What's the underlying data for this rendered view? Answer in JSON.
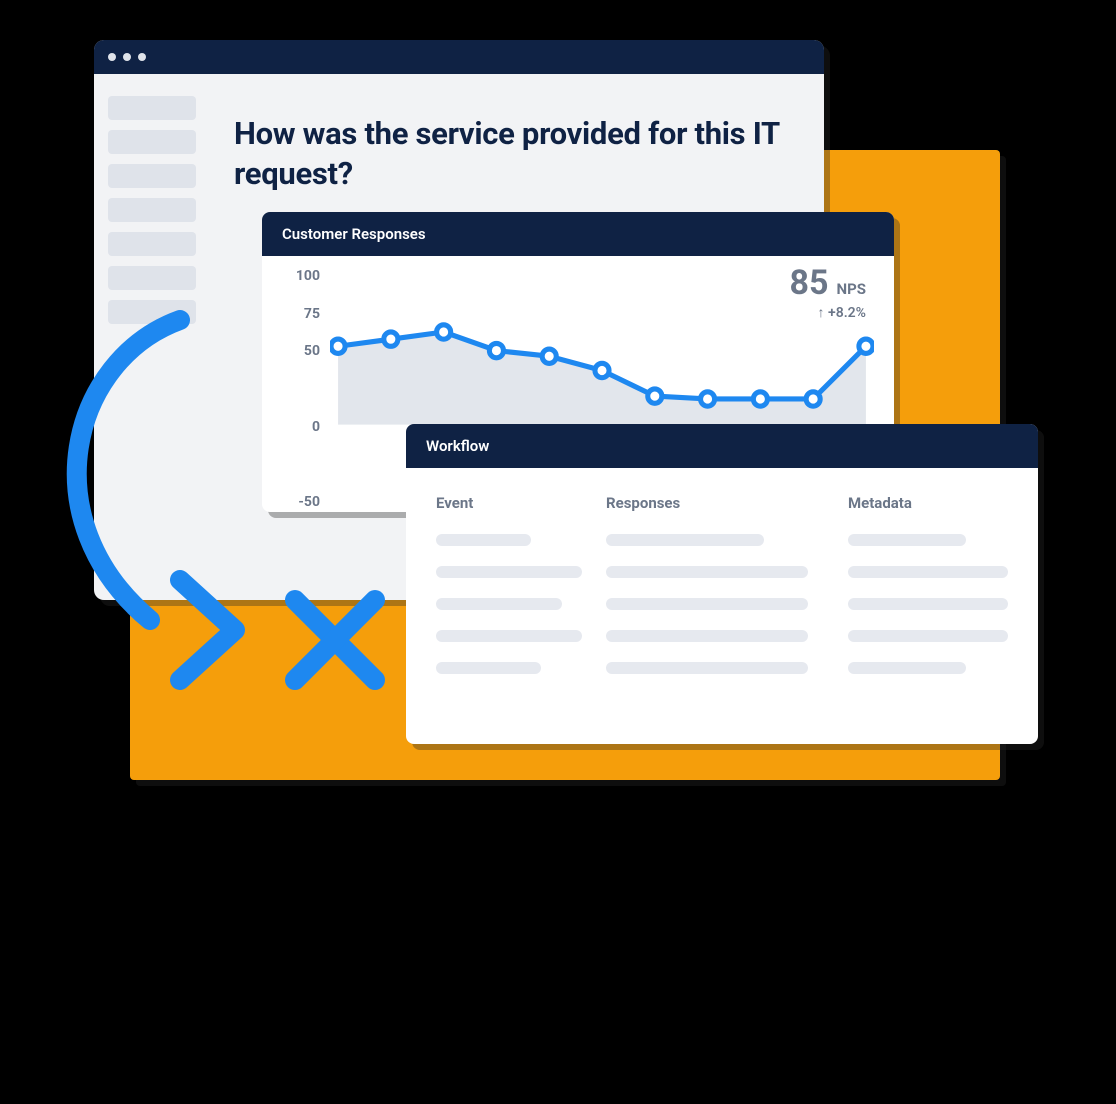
{
  "survey": {
    "question": "How was the service provided for this IT request?",
    "sidebar_items": 7
  },
  "responses_card": {
    "title": "Customer Responses",
    "metric_value": "85",
    "metric_unit": "NPS",
    "metric_delta": "↑ +8.2%"
  },
  "workflow_card": {
    "title": "Workflow",
    "columns": {
      "event": "Event",
      "responses": "Responses",
      "metadata": "Metadata"
    },
    "row_count": 5
  },
  "chart_data": {
    "type": "line",
    "title": "Customer Responses",
    "ylabel": "",
    "xlabel": "",
    "ylim": [
      -50,
      100
    ],
    "y_ticks": [
      100,
      75,
      50,
      0,
      -50
    ],
    "x": [
      1,
      2,
      3,
      4,
      5,
      6,
      7,
      8,
      9,
      10,
      11
    ],
    "values": [
      55,
      60,
      65,
      52,
      48,
      38,
      20,
      18,
      18,
      18,
      55
    ],
    "metric": {
      "value": 85,
      "unit": "NPS",
      "delta_pct": 8.2,
      "delta_direction": "up"
    }
  },
  "colors": {
    "accent": "#1e88f0",
    "orange": "#f59e0b",
    "header": "#0f2244",
    "muted_text": "#6b7688",
    "skeleton": "#e6e9ef"
  }
}
